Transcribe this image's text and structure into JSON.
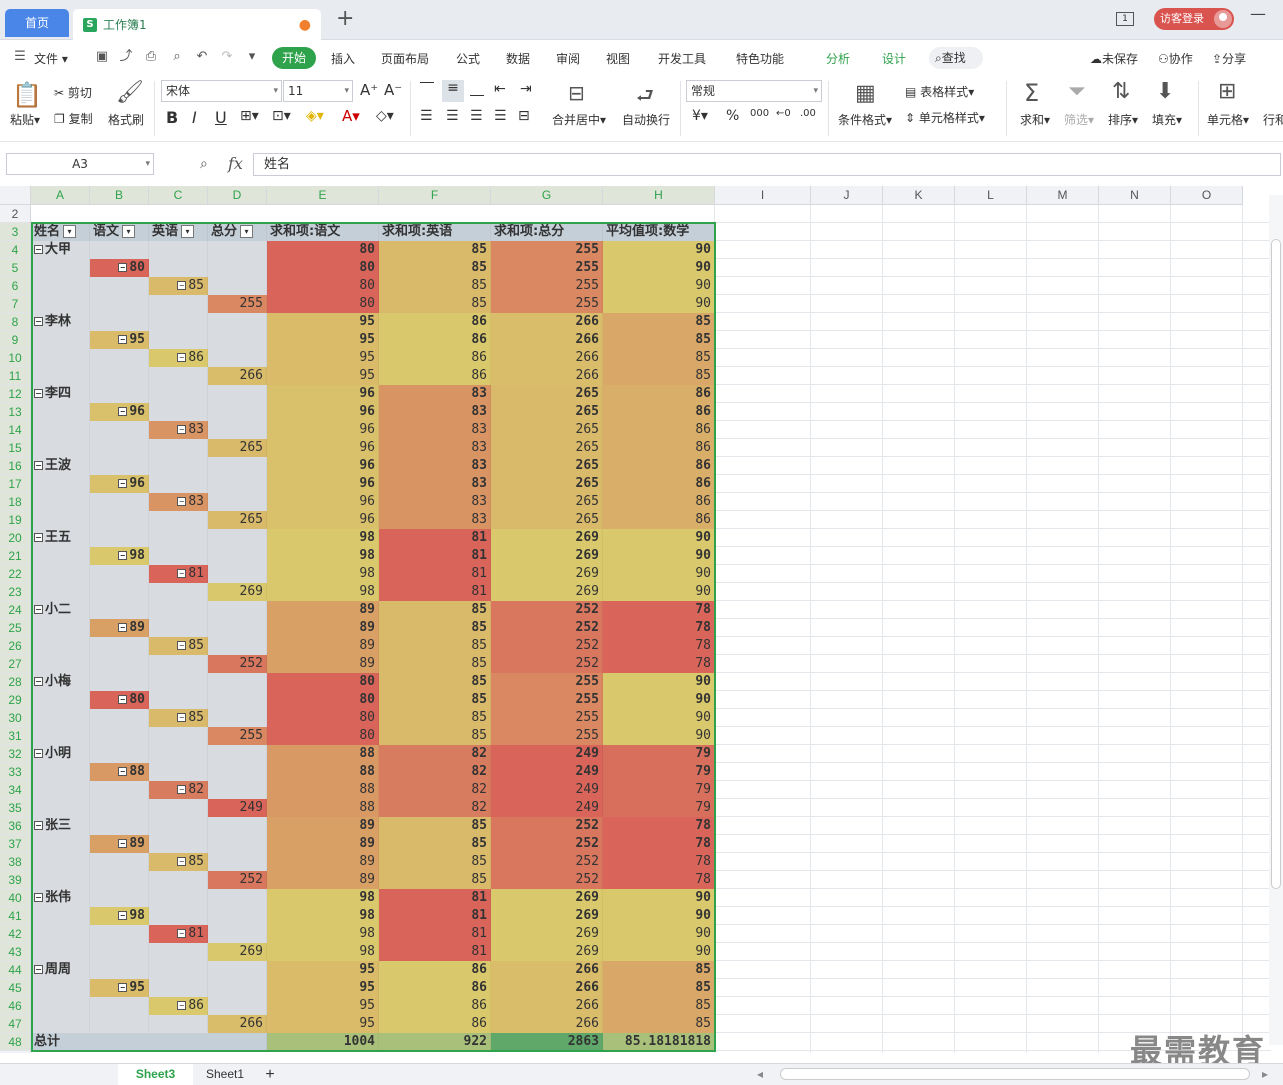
{
  "titlebar": {
    "home_tab": "首页",
    "doc_badge": "S",
    "doc_tab": "工作簿1",
    "page_indicator": "1",
    "login_label": "访客登录"
  },
  "menubar": {
    "file": "文件",
    "items": [
      "开始",
      "插入",
      "页面布局",
      "公式",
      "数据",
      "审阅",
      "视图",
      "开发工具",
      "特色功能",
      "分析",
      "设计"
    ],
    "search": "查找",
    "unsaved": "未保存",
    "collab": "协作",
    "share": "分享"
  },
  "ribbon": {
    "paste": "粘贴",
    "cut": "剪切",
    "copy": "复制",
    "format_painter": "格式刷",
    "font_name": "宋体",
    "font_size": "11",
    "merge_center": "合并居中",
    "wrap": "自动换行",
    "number_format": "常规",
    "cond_format": "条件格式",
    "table_style": "表格样式",
    "cell_style": "单元格样式",
    "sum": "求和",
    "filter": "筛选",
    "sort": "排序",
    "fill": "填充",
    "cell": "单元格",
    "row_col": "行和"
  },
  "formula": {
    "name_box": "A3",
    "fx": "fx",
    "value": "姓名"
  },
  "columns": [
    "A",
    "B",
    "C",
    "D",
    "E",
    "F",
    "G",
    "H",
    "I",
    "J",
    "K",
    "L",
    "M",
    "N",
    "O"
  ],
  "pivot": {
    "headers": [
      "姓名",
      "语文",
      "英语",
      "总分",
      "求和项:语文",
      "求和项:英语",
      "求和项:总分",
      "平均值项:数学"
    ],
    "groups": [
      {
        "name": "大甲",
        "yw": 80,
        "yy": 85,
        "zf": 255,
        "sx": 90
      },
      {
        "name": "李林",
        "yw": 95,
        "yy": 86,
        "zf": 266,
        "sx": 85
      },
      {
        "name": "李四",
        "yw": 96,
        "yy": 83,
        "zf": 265,
        "sx": 86
      },
      {
        "name": "王波",
        "yw": 96,
        "yy": 83,
        "zf": 265,
        "sx": 86
      },
      {
        "name": "王五",
        "yw": 98,
        "yy": 81,
        "zf": 269,
        "sx": 90
      },
      {
        "name": "小二",
        "yw": 89,
        "yy": 85,
        "zf": 252,
        "sx": 78
      },
      {
        "name": "小梅",
        "yw": 80,
        "yy": 85,
        "zf": 255,
        "sx": 90
      },
      {
        "name": "小明",
        "yw": 88,
        "yy": 82,
        "zf": 249,
        "sx": 79
      },
      {
        "name": "张三",
        "yw": 89,
        "yy": 85,
        "zf": 252,
        "sx": 78
      },
      {
        "name": "张伟",
        "yw": 98,
        "yy": 81,
        "zf": 269,
        "sx": 90
      },
      {
        "name": "周周",
        "yw": 95,
        "yy": 86,
        "zf": 266,
        "sx": 85
      }
    ],
    "total_label": "总计",
    "totals": [
      "1004",
      "922",
      "2863",
      "85.18181818"
    ]
  },
  "colors": {
    "accent": "#2fa24c",
    "yellow": "#d9c96c",
    "orange": "#d9a066",
    "red": "#d8645a",
    "label_bg": "#d8dbe0",
    "header_bg": "#c5cfd8"
  },
  "sheets": [
    "Sheet3",
    "Sheet1"
  ],
  "watermark": "最需教育"
}
